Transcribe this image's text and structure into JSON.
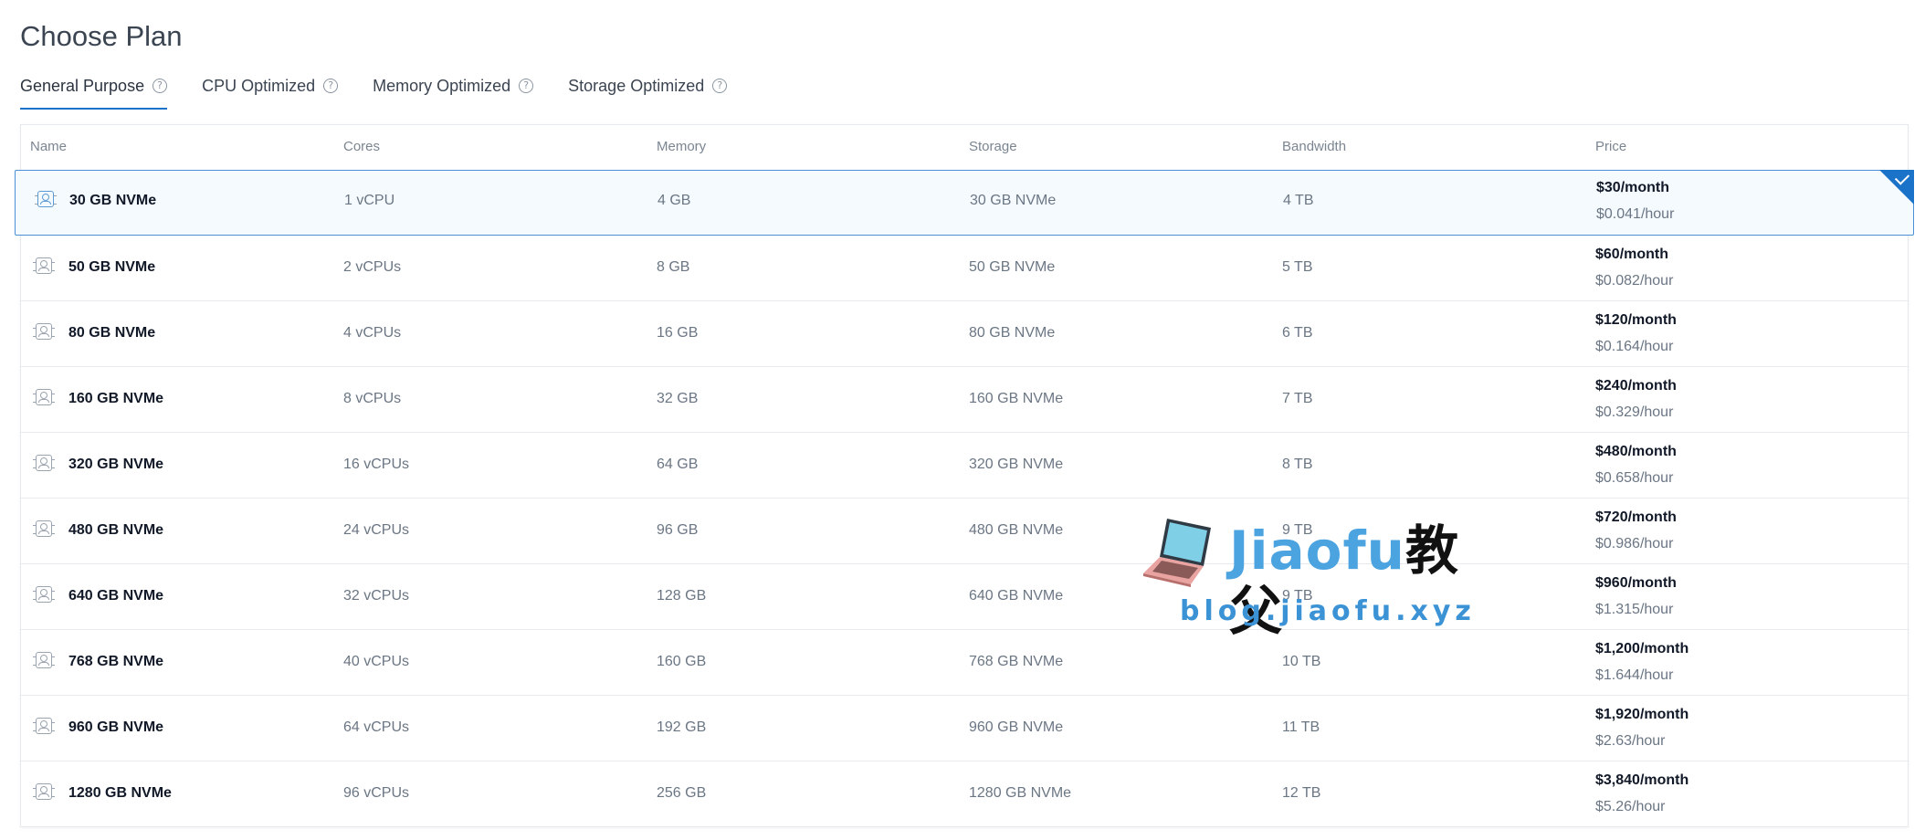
{
  "page_title": "Choose Plan",
  "tabs": [
    {
      "label": "General Purpose",
      "active": true
    },
    {
      "label": "CPU Optimized",
      "active": false
    },
    {
      "label": "Memory Optimized",
      "active": false
    },
    {
      "label": "Storage Optimized",
      "active": false
    }
  ],
  "columns": {
    "name": "Name",
    "cores": "Cores",
    "memory": "Memory",
    "storage": "Storage",
    "bandwidth": "Bandwidth",
    "price": "Price"
  },
  "plans": [
    {
      "name": "30 GB NVMe",
      "cores": "1 vCPU",
      "memory": "4 GB",
      "storage": "30 GB NVMe",
      "bandwidth": "4 TB",
      "price_month": "$30/month",
      "price_hour": "$0.041/hour",
      "selected": true
    },
    {
      "name": "50 GB NVMe",
      "cores": "2 vCPUs",
      "memory": "8 GB",
      "storage": "50 GB NVMe",
      "bandwidth": "5 TB",
      "price_month": "$60/month",
      "price_hour": "$0.082/hour",
      "selected": false
    },
    {
      "name": "80 GB NVMe",
      "cores": "4 vCPUs",
      "memory": "16 GB",
      "storage": "80 GB NVMe",
      "bandwidth": "6 TB",
      "price_month": "$120/month",
      "price_hour": "$0.164/hour",
      "selected": false
    },
    {
      "name": "160 GB NVMe",
      "cores": "8 vCPUs",
      "memory": "32 GB",
      "storage": "160 GB NVMe",
      "bandwidth": "7 TB",
      "price_month": "$240/month",
      "price_hour": "$0.329/hour",
      "selected": false
    },
    {
      "name": "320 GB NVMe",
      "cores": "16 vCPUs",
      "memory": "64 GB",
      "storage": "320 GB NVMe",
      "bandwidth": "8 TB",
      "price_month": "$480/month",
      "price_hour": "$0.658/hour",
      "selected": false
    },
    {
      "name": "480 GB NVMe",
      "cores": "24 vCPUs",
      "memory": "96 GB",
      "storage": "480 GB NVMe",
      "bandwidth": "9 TB",
      "price_month": "$720/month",
      "price_hour": "$0.986/hour",
      "selected": false
    },
    {
      "name": "640 GB NVMe",
      "cores": "32 vCPUs",
      "memory": "128 GB",
      "storage": "640 GB NVMe",
      "bandwidth": "9 TB",
      "price_month": "$960/month",
      "price_hour": "$1.315/hour",
      "selected": false
    },
    {
      "name": "768 GB NVMe",
      "cores": "40 vCPUs",
      "memory": "160 GB",
      "storage": "768 GB NVMe",
      "bandwidth": "10 TB",
      "price_month": "$1,200/month",
      "price_hour": "$1.644/hour",
      "selected": false
    },
    {
      "name": "960 GB NVMe",
      "cores": "64 vCPUs",
      "memory": "192 GB",
      "storage": "960 GB NVMe",
      "bandwidth": "11 TB",
      "price_month": "$1,920/month",
      "price_hour": "$2.63/hour",
      "selected": false
    },
    {
      "name": "1280 GB NVMe",
      "cores": "96 vCPUs",
      "memory": "256 GB",
      "storage": "1280 GB NVMe",
      "bandwidth": "12 TB",
      "price_month": "$3,840/month",
      "price_hour": "$5.26/hour",
      "selected": false
    }
  ],
  "watermark": {
    "brand": "Jiaofu",
    "brand_cn": "教父",
    "url": "blog.jiaofu.xyz"
  },
  "icons": {
    "plan_icon": "server-chip-icon",
    "help_icon": "question-circle-icon",
    "selected_icon": "check-icon"
  },
  "colors": {
    "accent": "#1a73c8",
    "selected_border": "#4a90d9",
    "selected_bg": "#f5faff"
  }
}
